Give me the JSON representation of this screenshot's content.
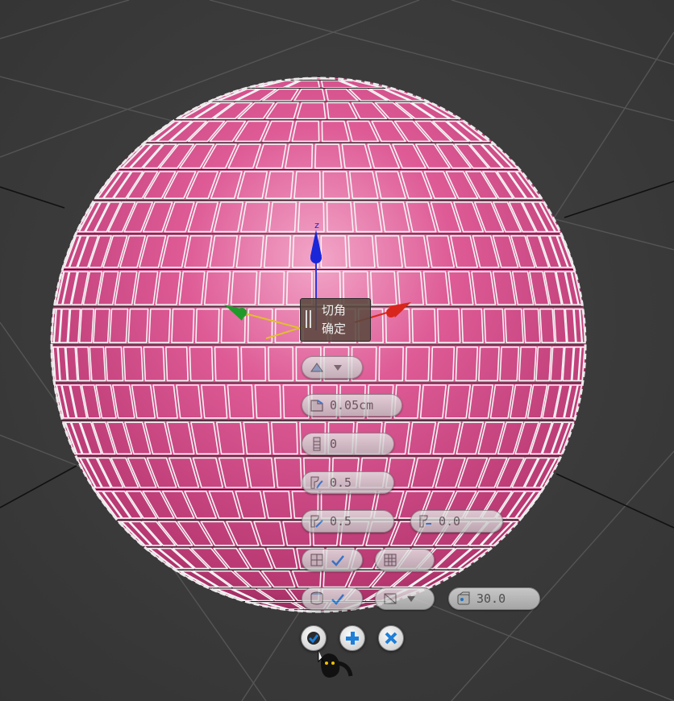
{
  "caddy": {
    "title_line1": "切角",
    "title_line2": "确定"
  },
  "fields": {
    "amount_value": "0.05cm",
    "segments_value": "0",
    "tension_value": "0.5",
    "depth_value": "0.5",
    "width_value": "0.0",
    "threshold_value": "30.0"
  },
  "colors": {
    "sphere": "#d84e8a",
    "wire": "#f4f4f4",
    "background": "#3a3a3a",
    "gizmo_x": "#d8261c",
    "gizmo_y": "#1f9a2a",
    "gizmo_z": "#1a26d8",
    "accent": "#1e7fd8"
  },
  "icons": [
    "chamfer-type-icon",
    "amount-icon",
    "segments-icon",
    "tension-icon",
    "depth-icon",
    "width-icon",
    "smooth-icon",
    "threshold-icon",
    "ok-icon",
    "apply-icon",
    "cancel-icon"
  ]
}
